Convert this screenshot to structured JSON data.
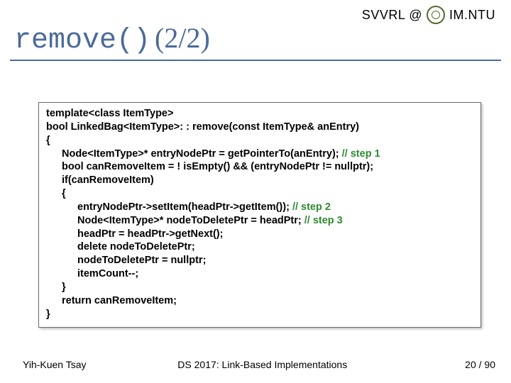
{
  "header": {
    "left": "SVVRL @",
    "right": "IM.NTU"
  },
  "title": {
    "mono": "remove()",
    "suffix": "(2/2)"
  },
  "code": {
    "lines": [
      {
        "indent": 0,
        "text": "template<class ItemType>"
      },
      {
        "indent": 0,
        "text": "bool LinkedBag<ItemType>: : remove(const ItemType& anEntry)"
      },
      {
        "indent": 0,
        "text": "{"
      },
      {
        "indent": 1,
        "text": "Node<ItemType>* entryNodePtr = getPointerTo(anEntry);",
        "comment": " // step 1"
      },
      {
        "indent": 1,
        "text": "bool canRemoveItem = ! isEmpty() && (entryNodePtr != nullptr);"
      },
      {
        "indent": 1,
        "text": "if(canRemoveItem)"
      },
      {
        "indent": 1,
        "text": "{"
      },
      {
        "indent": 2,
        "text": "entryNodePtr->setItem(headPtr->getItem());",
        "comment": " // step 2"
      },
      {
        "indent": 2,
        "text": "Node<ItemType>* nodeToDeletePtr = headPtr;",
        "comment": " // step 3"
      },
      {
        "indent": 2,
        "text": "headPtr = headPtr->getNext();"
      },
      {
        "indent": 2,
        "text": "delete nodeToDeletePtr;"
      },
      {
        "indent": 2,
        "text": "nodeToDeletePtr = nullptr;"
      },
      {
        "indent": 2,
        "text": "itemCount--;"
      },
      {
        "indent": 1,
        "text": "}"
      },
      {
        "indent": 1,
        "text": "return canRemoveItem;"
      },
      {
        "indent": 0,
        "text": "}"
      }
    ]
  },
  "footer": {
    "author": "Yih-Kuen Tsay",
    "course": "DS 2017: Link-Based Implementations",
    "page": "20 / 90"
  }
}
